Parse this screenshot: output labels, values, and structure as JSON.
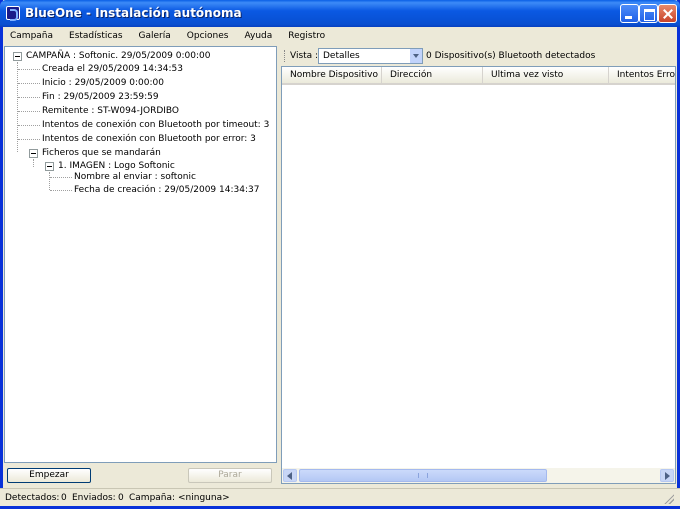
{
  "window": {
    "title": "BlueOne - Instalación autónoma"
  },
  "menu": {
    "items": [
      {
        "label": "Campaña"
      },
      {
        "label": "Estadísticas"
      },
      {
        "label": "Galería"
      },
      {
        "label": "Opciones"
      },
      {
        "label": "Ayuda"
      },
      {
        "label": "Registro"
      }
    ]
  },
  "tree": {
    "root": "CAMPAÑA : Softonic. 29/05/2009 0:00:00",
    "details": [
      "Creada el 29/05/2009 14:34:53",
      "Inicio : 29/05/2009 0:00:00",
      "Fin : 29/05/2009 23:59:59",
      "Remitente : ST-W094-JORDIBO",
      "Intentos de conexión con Bluetooth por timeout: 3",
      "Intentos de conexión con Bluetooth por error: 3"
    ],
    "files_node": "Ficheros que se mandarán",
    "image_node": "1. IMAGEN : Logo Softonic",
    "image_details": [
      "Nombre al enviar : softonic",
      "Fecha de creación : 29/05/2009 14:34:37"
    ]
  },
  "buttons": {
    "start": "Empezar",
    "stop": "Parar"
  },
  "toolbar": {
    "vista_label": "Vista :",
    "vista_value": "Detalles",
    "device_status": "0 Dispositivo(s) Bluetooth detectados"
  },
  "list": {
    "columns": [
      "Nombre Dispositivo",
      "Dirección",
      "Ultima vez visto",
      "Intentos Error"
    ]
  },
  "status": {
    "detected_label": "Detectados:",
    "detected_value": "0",
    "sent_label": "Enviados:",
    "sent_value": "0",
    "campaign_label": "Campaña:",
    "campaign_value": "<ninguna>"
  },
  "colors": {
    "titlebar": "#0a59e3",
    "window_bg": "#ece9d8",
    "panel_border": "#7f9db9"
  },
  "icons": [
    "app-icon",
    "minimize-icon",
    "maximize-icon",
    "close-icon",
    "dropdown-arrow-icon",
    "scroll-left-icon",
    "scroll-right-icon",
    "resize-grip-icon"
  ]
}
